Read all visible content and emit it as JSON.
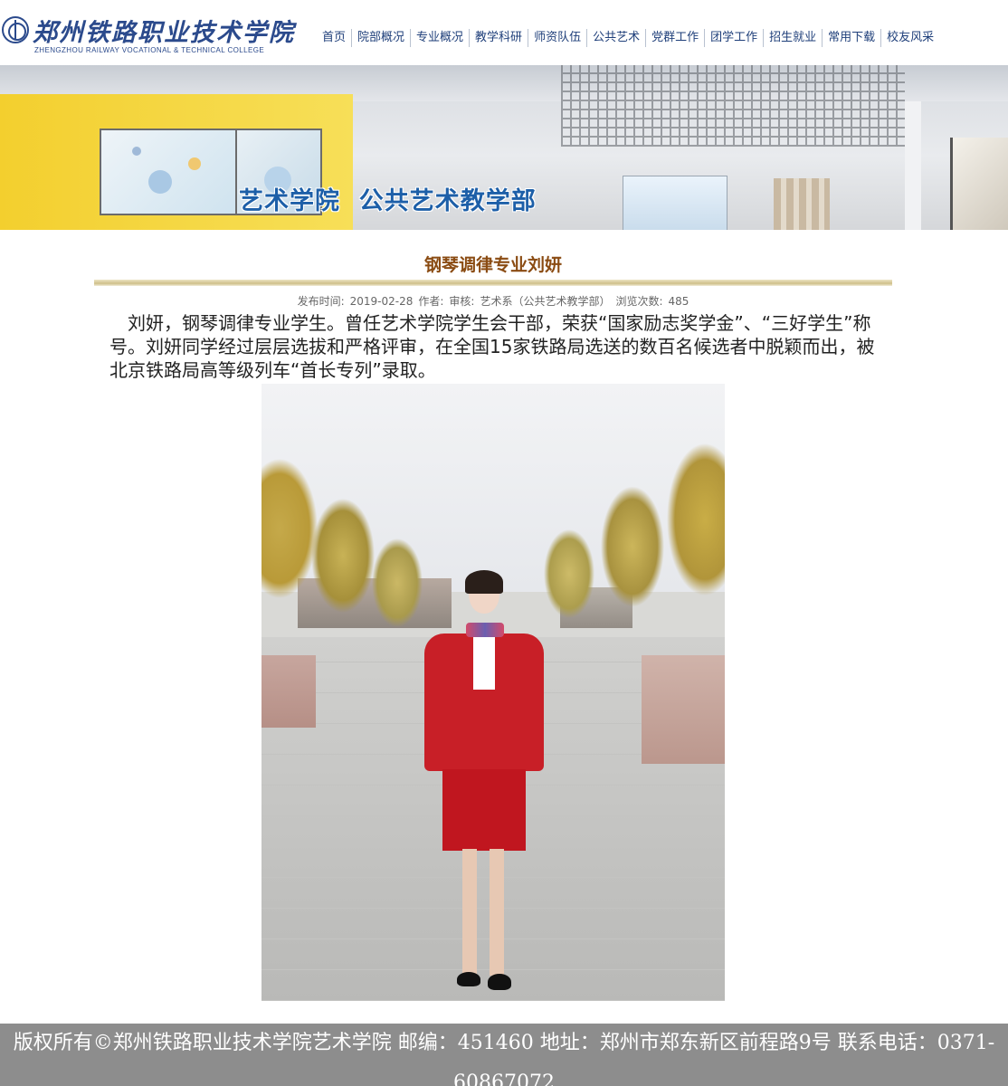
{
  "header": {
    "logo_cn": "郑州铁路职业技术学院",
    "logo_en": "ZHENGZHOU RAILWAY VOCATIONAL & TECHNICAL COLLEGE",
    "brand_color": "#2b4a8c"
  },
  "nav": {
    "items": [
      "首页",
      "院部概况",
      "专业概况",
      "教学科研",
      "师资队伍",
      "公共艺术",
      "党群工作",
      "团学工作",
      "招生就业",
      "常用下载",
      "校友风采"
    ]
  },
  "banner": {
    "title": "艺术学院  公共艺术教学部"
  },
  "article": {
    "title": "钢琴调律专业刘妍",
    "meta": {
      "publish_label": "发布时间:",
      "publish_date": "2019-02-28",
      "author_label": "作者:",
      "reviewer_label": "审核:",
      "department": "艺术系（公共艺术教学部）",
      "views_label": "浏览次数:",
      "views": "485"
    },
    "body": "刘妍，钢琴调律专业学生。曾任艺术学院学生会干部，荣获“国家励志奖学金”、“三好学生”称号。刘妍同学经过层层选拔和严格评审，在全国15家铁路局选送的数百名候选者中脱颖而出，被北京铁路局高等级列车“首长专列”录取。"
  },
  "footer": {
    "text": "版权所有©郑州铁路职业技术学院艺术学院 邮编：451460 地址：郑州市郑东新区前程路9号 联系电话：0371-60867072"
  }
}
